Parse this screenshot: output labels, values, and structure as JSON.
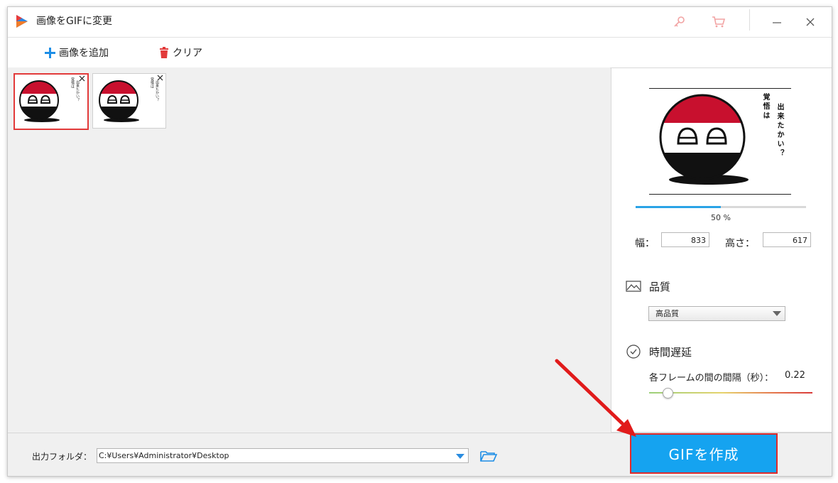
{
  "window": {
    "title": "画像をGIFに変更"
  },
  "titlebar_icons": [
    "app-logo-icon",
    "key-icon",
    "cart-icon",
    "minimize-icon",
    "close-icon"
  ],
  "toolbar": {
    "add_image_label": "画像を追加",
    "clear_label": "クリア"
  },
  "thumbnails": [
    {
      "selected": true,
      "text_col1": "覚悟は",
      "text_col2": "出来たかい？"
    },
    {
      "selected": false,
      "text_col1": "覚悟は",
      "text_col2": "出来たかい？"
    }
  ],
  "preview": {
    "text_col1": "覚悟は",
    "text_col2": "出来たかい？",
    "zoom_percent": 50,
    "zoom_label": "50 %"
  },
  "size": {
    "width_label": "幅：",
    "width_value": "833",
    "height_label": "高さ：",
    "height_value": "617"
  },
  "quality": {
    "title": "品質",
    "selected": "高品質"
  },
  "delay": {
    "title": "時間遅延",
    "label": "各フレームの間の間隔（秒）：",
    "value": "0.22",
    "slider_fraction": 0.11
  },
  "output": {
    "label": "出力フォルダ：",
    "path": "C:¥Users¥Administrator¥Desktop"
  },
  "create_button": {
    "label": "GIFを作成"
  },
  "colors": {
    "accent": "#15a3f0",
    "highlight": "#e02a2a",
    "flag_red": "#c8102e",
    "flag_black": "#111111"
  }
}
